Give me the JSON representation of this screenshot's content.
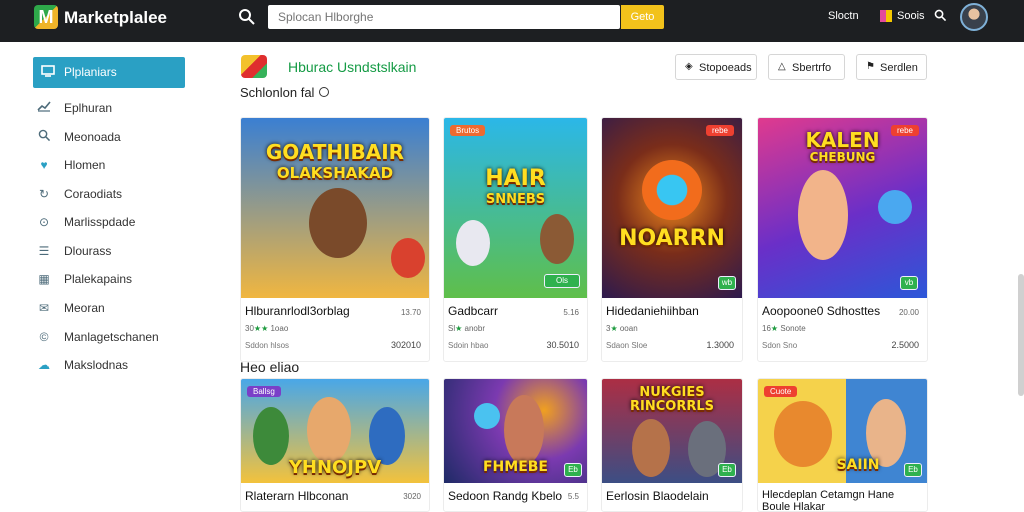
{
  "app": {
    "name": "Marketplalee",
    "search_placeholder": "Splocan Hlborghe",
    "search_button": "Geto",
    "top_links": [
      "Sloctn",
      "Soois"
    ]
  },
  "sidebar": {
    "active_item": {
      "label": "Plplaniars",
      "icon": "monitor-icon"
    },
    "items": [
      {
        "label": "Eplhuran",
        "icon": "chart-icon"
      },
      {
        "label": "Meonoada",
        "icon": "search-icon"
      },
      {
        "label": "Hlomen",
        "icon": "heart-icon"
      },
      {
        "label": "Coraodiats",
        "icon": "refresh-icon"
      },
      {
        "label": "Marlisspdade",
        "icon": "settings-icon"
      },
      {
        "label": "Dlourass",
        "icon": "list-icon"
      },
      {
        "label": "Plalekapains",
        "icon": "grid-icon"
      },
      {
        "label": "Meoran",
        "icon": "mail-icon"
      },
      {
        "label": "Manlagetschanen",
        "icon": "badge-icon"
      },
      {
        "label": "Makslodnas",
        "icon": "cloud-icon"
      }
    ]
  },
  "section": {
    "title": "Hburac Usndstslkain",
    "sort_label": "Schlonlon fal",
    "filters": [
      {
        "label": "Stopoeads",
        "icon": "tag-icon"
      },
      {
        "label": "Sbertrfo",
        "icon": "triangle-icon"
      },
      {
        "label": "Serdlen",
        "icon": "flag-icon"
      }
    ],
    "hot_title": "Heo eliao"
  },
  "featured_cards": [
    {
      "name": "Hlburanrlodl3orblag",
      "meta": "13.70",
      "rating_prefix": "30",
      "rating_suffix": "1oao",
      "sub": "Sddon hlsos",
      "price": "302010",
      "art_text": [
        "GOATHIBAIR",
        "OLAKSHAKAD"
      ],
      "tag": "",
      "badge": "",
      "colors": [
        "#3a7fd2",
        "#f0b640"
      ]
    },
    {
      "name": "Gadbcarr",
      "meta": "5.16",
      "rating_prefix": "Sl",
      "rating_suffix": "anobr",
      "sub": "Sdoin hbao",
      "price": "30.5010",
      "art_text": [
        "HAIR",
        "SNNEBS"
      ],
      "tag": "Brutos",
      "badge": "Ols",
      "colors": [
        "#2bb7e8",
        "#5fbf4a"
      ]
    },
    {
      "name": "Hidedaniehiihban",
      "meta": "",
      "rating_prefix": "3",
      "rating_suffix": "ooan",
      "sub": "Sdaon Sloe",
      "price": "1.3000",
      "art_text": [
        "NOARRN"
      ],
      "tag": "rebe",
      "badge": "wb",
      "colors": [
        "#2d1a4e",
        "#f08a1c"
      ]
    },
    {
      "name": "Aoopoone0 Sdhosttes",
      "meta": "20.00",
      "rating_prefix": "16",
      "rating_suffix": "Sonote",
      "sub": "Sdon Sno",
      "price": "2.5000",
      "art_text": [
        "KALEN",
        "CHEBUNG"
      ],
      "tag": "rebe",
      "badge": "vb",
      "colors": [
        "#6a2fc8",
        "#e03a8e"
      ]
    }
  ],
  "hot_cards": [
    {
      "name": "Rlaterarn Hlbconan",
      "meta": "3020",
      "art_text": [
        "YHNOJPV"
      ],
      "tag": "Ballsg",
      "badge": "",
      "colors": [
        "#49a7e8",
        "#f3c23c"
      ]
    },
    {
      "name": "Sedoon Randg Kbelo",
      "meta": "5.5",
      "art_text": [
        "FHMEBE"
      ],
      "tag": "",
      "badge": "Eb",
      "colors": [
        "#1e2a66",
        "#f0a020"
      ]
    },
    {
      "name": "Eerlosin Blaodelain",
      "meta": "",
      "art_text": [
        "NUKGIES",
        "RINCORRLS"
      ],
      "tag": "",
      "badge": "Eb",
      "colors": [
        "#ac2e44",
        "#3c4e84"
      ]
    },
    {
      "name": "Hlecdeplan Cetamgn Hane",
      "name2": "Boule Hlakar",
      "meta": "",
      "art_text": [
        "SAIIN"
      ],
      "tag": "Cuote",
      "badge": "Eb",
      "colors": [
        "#f5d24b",
        "#3f85d2"
      ]
    }
  ]
}
